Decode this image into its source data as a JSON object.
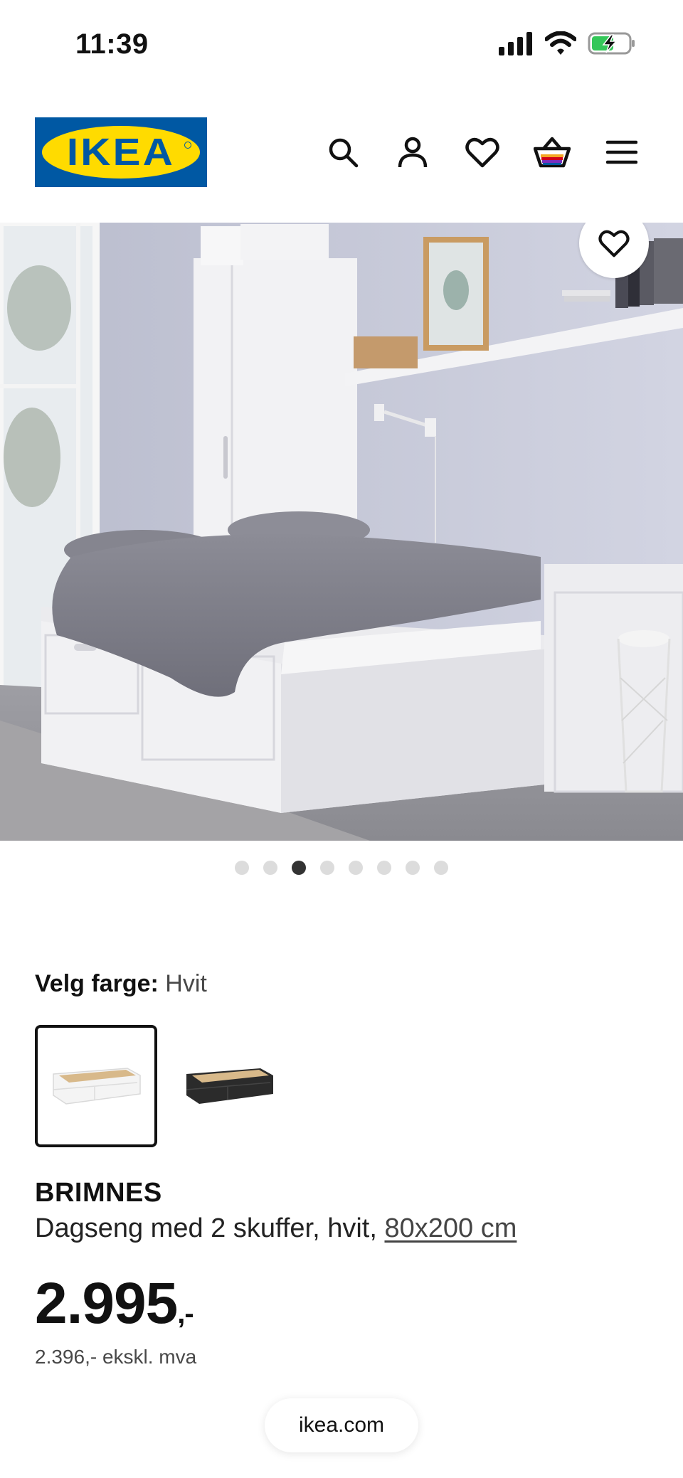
{
  "status_bar": {
    "time": "11:39",
    "icons": [
      "cellular-signal-icon",
      "wifi-icon",
      "battery-charging-icon"
    ],
    "battery_color": "#34c759"
  },
  "header": {
    "logo_text": "IKEA",
    "brand_colors": {
      "blue": "#0058a3",
      "yellow": "#ffdb00"
    },
    "icons": [
      "search-icon",
      "account-icon",
      "heart-icon",
      "shopping-bag-icon",
      "menu-icon"
    ]
  },
  "gallery": {
    "total_images": 8,
    "active_index": 3,
    "favorite_icon": "heart-icon"
  },
  "color_selector": {
    "label": "Velg farge:",
    "selected": "Hvit",
    "options": [
      {
        "name": "Hvit",
        "color": "#f2f2f2"
      },
      {
        "name": "Svart",
        "color": "#2b2b2b"
      }
    ]
  },
  "product": {
    "name": "BRIMNES",
    "description": "Dagseng med 2 skuffer, hvit, ",
    "size_link": "80x200 cm",
    "price_main": "2.995",
    "price_suffix": ",-",
    "price_ex_vat": "2.396,- ekskl. mva"
  },
  "browser": {
    "url": "ikea.com"
  }
}
